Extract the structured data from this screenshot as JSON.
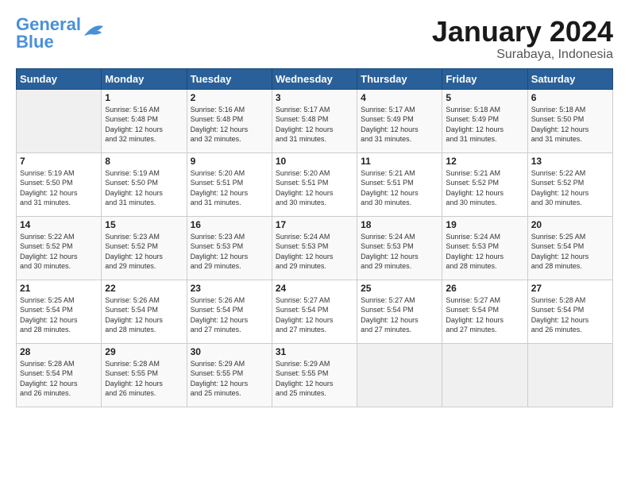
{
  "logo": {
    "line1": "General",
    "line2": "Blue"
  },
  "title": "January 2024",
  "subtitle": "Surabaya, Indonesia",
  "days_header": [
    "Sunday",
    "Monday",
    "Tuesday",
    "Wednesday",
    "Thursday",
    "Friday",
    "Saturday"
  ],
  "weeks": [
    [
      {
        "day": "",
        "info": ""
      },
      {
        "day": "1",
        "info": "Sunrise: 5:16 AM\nSunset: 5:48 PM\nDaylight: 12 hours\nand 32 minutes."
      },
      {
        "day": "2",
        "info": "Sunrise: 5:16 AM\nSunset: 5:48 PM\nDaylight: 12 hours\nand 32 minutes."
      },
      {
        "day": "3",
        "info": "Sunrise: 5:17 AM\nSunset: 5:48 PM\nDaylight: 12 hours\nand 31 minutes."
      },
      {
        "day": "4",
        "info": "Sunrise: 5:17 AM\nSunset: 5:49 PM\nDaylight: 12 hours\nand 31 minutes."
      },
      {
        "day": "5",
        "info": "Sunrise: 5:18 AM\nSunset: 5:49 PM\nDaylight: 12 hours\nand 31 minutes."
      },
      {
        "day": "6",
        "info": "Sunrise: 5:18 AM\nSunset: 5:50 PM\nDaylight: 12 hours\nand 31 minutes."
      }
    ],
    [
      {
        "day": "7",
        "info": "Sunrise: 5:19 AM\nSunset: 5:50 PM\nDaylight: 12 hours\nand 31 minutes."
      },
      {
        "day": "8",
        "info": "Sunrise: 5:19 AM\nSunset: 5:50 PM\nDaylight: 12 hours\nand 31 minutes."
      },
      {
        "day": "9",
        "info": "Sunrise: 5:20 AM\nSunset: 5:51 PM\nDaylight: 12 hours\nand 31 minutes."
      },
      {
        "day": "10",
        "info": "Sunrise: 5:20 AM\nSunset: 5:51 PM\nDaylight: 12 hours\nand 30 minutes."
      },
      {
        "day": "11",
        "info": "Sunrise: 5:21 AM\nSunset: 5:51 PM\nDaylight: 12 hours\nand 30 minutes."
      },
      {
        "day": "12",
        "info": "Sunrise: 5:21 AM\nSunset: 5:52 PM\nDaylight: 12 hours\nand 30 minutes."
      },
      {
        "day": "13",
        "info": "Sunrise: 5:22 AM\nSunset: 5:52 PM\nDaylight: 12 hours\nand 30 minutes."
      }
    ],
    [
      {
        "day": "14",
        "info": "Sunrise: 5:22 AM\nSunset: 5:52 PM\nDaylight: 12 hours\nand 30 minutes."
      },
      {
        "day": "15",
        "info": "Sunrise: 5:23 AM\nSunset: 5:52 PM\nDaylight: 12 hours\nand 29 minutes."
      },
      {
        "day": "16",
        "info": "Sunrise: 5:23 AM\nSunset: 5:53 PM\nDaylight: 12 hours\nand 29 minutes."
      },
      {
        "day": "17",
        "info": "Sunrise: 5:24 AM\nSunset: 5:53 PM\nDaylight: 12 hours\nand 29 minutes."
      },
      {
        "day": "18",
        "info": "Sunrise: 5:24 AM\nSunset: 5:53 PM\nDaylight: 12 hours\nand 29 minutes."
      },
      {
        "day": "19",
        "info": "Sunrise: 5:24 AM\nSunset: 5:53 PM\nDaylight: 12 hours\nand 28 minutes."
      },
      {
        "day": "20",
        "info": "Sunrise: 5:25 AM\nSunset: 5:54 PM\nDaylight: 12 hours\nand 28 minutes."
      }
    ],
    [
      {
        "day": "21",
        "info": "Sunrise: 5:25 AM\nSunset: 5:54 PM\nDaylight: 12 hours\nand 28 minutes."
      },
      {
        "day": "22",
        "info": "Sunrise: 5:26 AM\nSunset: 5:54 PM\nDaylight: 12 hours\nand 28 minutes."
      },
      {
        "day": "23",
        "info": "Sunrise: 5:26 AM\nSunset: 5:54 PM\nDaylight: 12 hours\nand 27 minutes."
      },
      {
        "day": "24",
        "info": "Sunrise: 5:27 AM\nSunset: 5:54 PM\nDaylight: 12 hours\nand 27 minutes."
      },
      {
        "day": "25",
        "info": "Sunrise: 5:27 AM\nSunset: 5:54 PM\nDaylight: 12 hours\nand 27 minutes."
      },
      {
        "day": "26",
        "info": "Sunrise: 5:27 AM\nSunset: 5:54 PM\nDaylight: 12 hours\nand 27 minutes."
      },
      {
        "day": "27",
        "info": "Sunrise: 5:28 AM\nSunset: 5:54 PM\nDaylight: 12 hours\nand 26 minutes."
      }
    ],
    [
      {
        "day": "28",
        "info": "Sunrise: 5:28 AM\nSunset: 5:54 PM\nDaylight: 12 hours\nand 26 minutes."
      },
      {
        "day": "29",
        "info": "Sunrise: 5:28 AM\nSunset: 5:55 PM\nDaylight: 12 hours\nand 26 minutes."
      },
      {
        "day": "30",
        "info": "Sunrise: 5:29 AM\nSunset: 5:55 PM\nDaylight: 12 hours\nand 25 minutes."
      },
      {
        "day": "31",
        "info": "Sunrise: 5:29 AM\nSunset: 5:55 PM\nDaylight: 12 hours\nand 25 minutes."
      },
      {
        "day": "",
        "info": ""
      },
      {
        "day": "",
        "info": ""
      },
      {
        "day": "",
        "info": ""
      }
    ]
  ]
}
